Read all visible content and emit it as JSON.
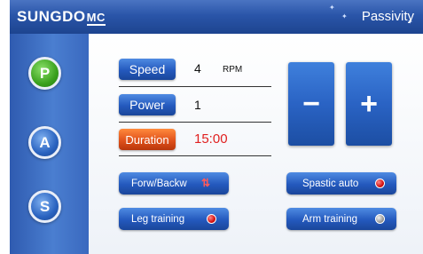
{
  "header": {
    "logo_text": "SUNGDO",
    "logo_suffix": "MC",
    "mode_title": "Passivity"
  },
  "sidebar": {
    "buttons": [
      {
        "label": "P",
        "color": "#3aa11d"
      },
      {
        "label": "A",
        "color": "#2a63c0"
      },
      {
        "label": "S",
        "color": "#2a63c0"
      }
    ]
  },
  "parameters": {
    "speed": {
      "label": "Speed",
      "value": "4",
      "unit": "RPM"
    },
    "power": {
      "label": "Power",
      "value": "1"
    },
    "duration": {
      "label": "Duration",
      "value": "15:00",
      "value_color": "#e02020"
    }
  },
  "adjust": {
    "minus": "−",
    "plus": "+"
  },
  "options": {
    "forw_backw": {
      "label": "Forw/Backw",
      "icon": "direction-arrows-icon"
    },
    "spastic_auto": {
      "label": "Spastic auto",
      "indicator": "red"
    },
    "leg_training": {
      "label": "Leg training",
      "indicator": "red"
    },
    "arm_training": {
      "label": "Arm training",
      "indicator": "grey"
    }
  },
  "colors": {
    "header": "#2a55a9",
    "button_blue": "#2459bd",
    "button_orange": "#e0521c",
    "indicator_red": "#d40f0f"
  }
}
